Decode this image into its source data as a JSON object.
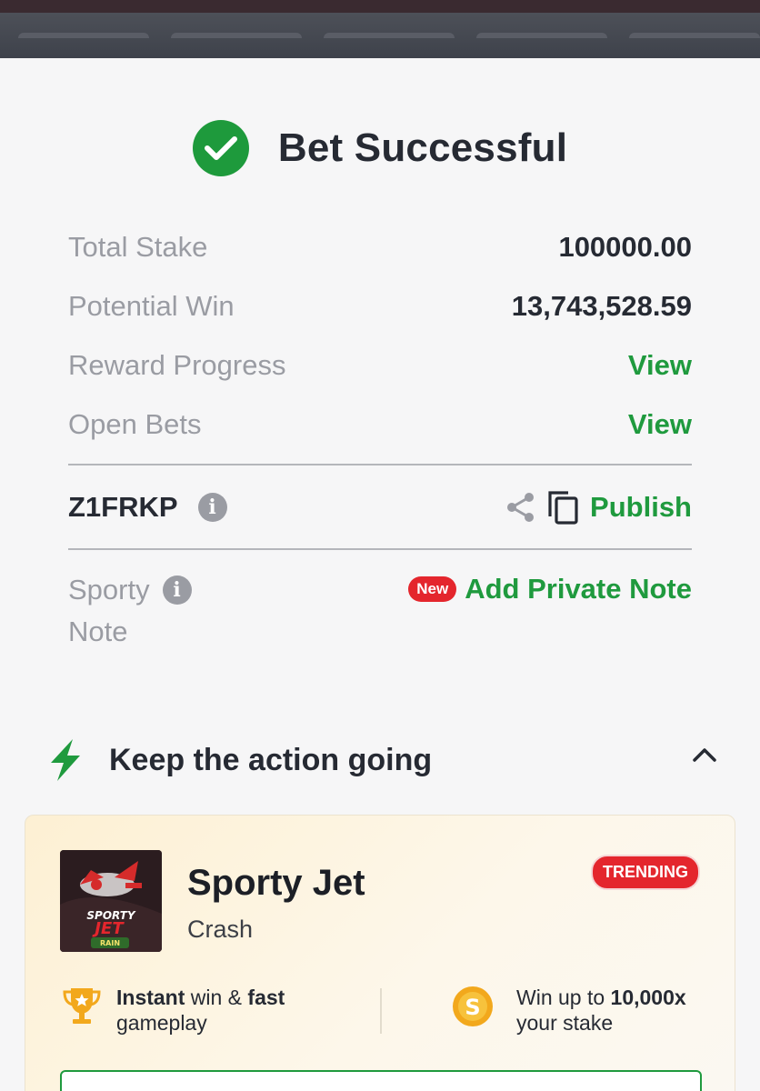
{
  "header": {
    "title": "Bet Successful"
  },
  "summary": [
    {
      "label": "Total Stake",
      "value": "100000.00",
      "type": "value"
    },
    {
      "label": "Potential Win",
      "value": "13,743,528.59",
      "type": "value"
    },
    {
      "label": "Reward Progress",
      "value": "View",
      "type": "link"
    },
    {
      "label": "Open Bets",
      "value": "View",
      "type": "link"
    }
  ],
  "booking": {
    "code": "Z1FRKP",
    "publish_label": "Publish"
  },
  "note": {
    "label_line1": "Sporty",
    "label_line2": "Note",
    "badge": "New",
    "action": "Add Private Note"
  },
  "promo": {
    "title": "Keep the action going",
    "game": {
      "name": "Sporty Jet",
      "category": "Crash",
      "badge": "TRENDING",
      "thumb_text": "SPORTY JET",
      "thumb_sub": "RAIN"
    },
    "features": [
      {
        "bold1": "Instant",
        "mid": " win & ",
        "bold2": "fast",
        "line2": "gameplay"
      },
      {
        "line1_pre": "Win up to ",
        "line1_bold": "10,000x",
        "line2": "your stake"
      }
    ]
  },
  "colors": {
    "accent_green": "#1f9a3e",
    "badge_red": "#e4262d"
  }
}
